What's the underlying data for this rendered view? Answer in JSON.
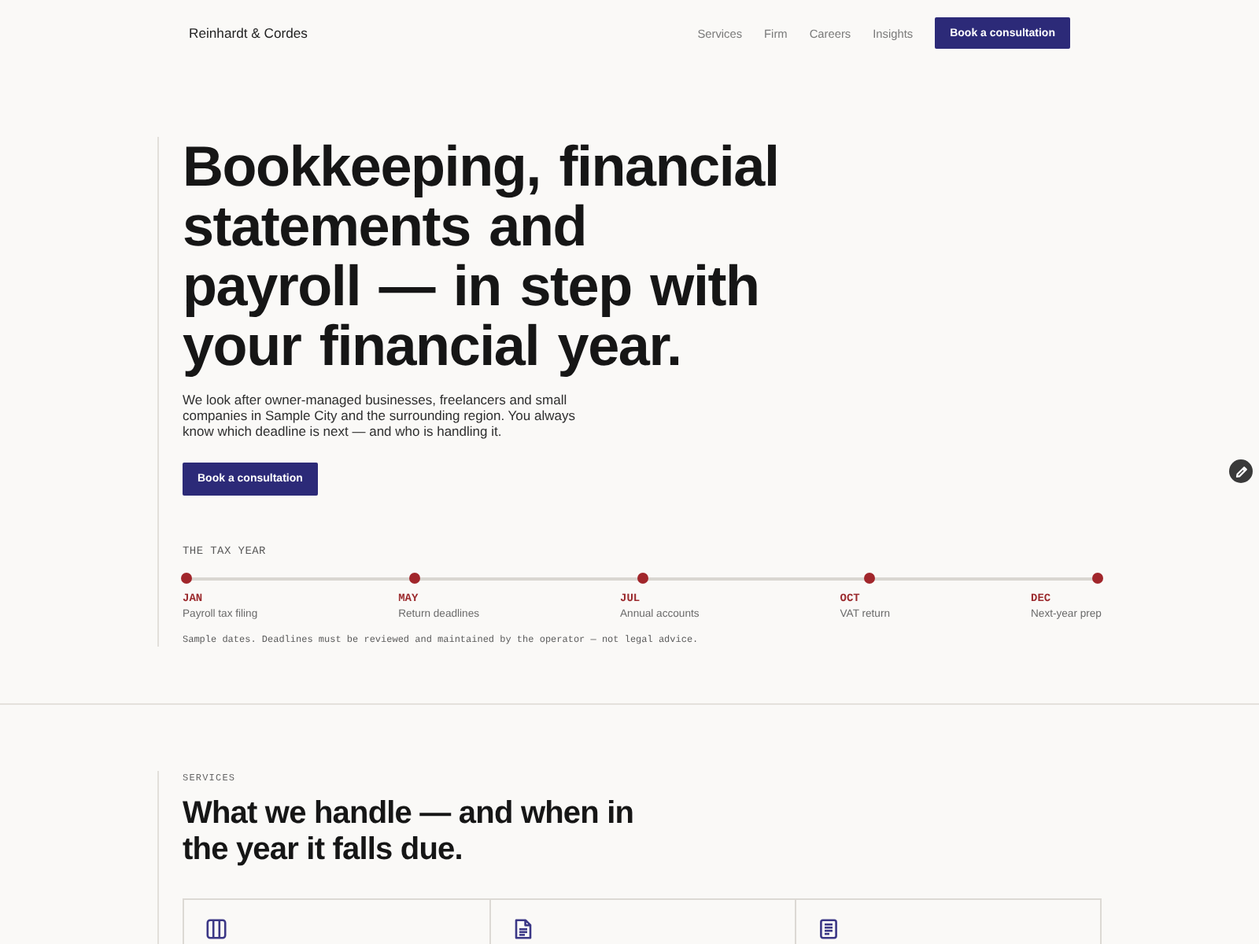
{
  "header": {
    "brand": "Reinhardt & Cordes",
    "nav": [
      "Services",
      "Firm",
      "Careers",
      "Insights"
    ],
    "cta": "Book a consultation"
  },
  "hero": {
    "headline": "Bookkeeping, financial statements and payroll — in step with your financial year.",
    "intro": "We look after owner-managed businesses, freelancers and small companies in Sample City and the surrounding region. You always know which deadline is next — and who is handling it.",
    "cta": "Book a consultation"
  },
  "tax_year": {
    "label": "THE TAX YEAR",
    "milestones": [
      {
        "month": "JAN",
        "task": "Payroll tax filing"
      },
      {
        "month": "MAY",
        "task": "Return deadlines"
      },
      {
        "month": "JUL",
        "task": "Annual accounts"
      },
      {
        "month": "OCT",
        "task": "VAT return"
      },
      {
        "month": "DEC",
        "task": "Next-year prep"
      }
    ],
    "note": "Sample dates. Deadlines must be reviewed and maintained by the operator — not legal advice."
  },
  "services": {
    "eyebrow": "SERVICES",
    "heading": "What we handle — and when in the year it falls due.",
    "cards": [
      {
        "kind": "ledger"
      },
      {
        "kind": "document"
      },
      {
        "kind": "receipt"
      }
    ]
  }
}
